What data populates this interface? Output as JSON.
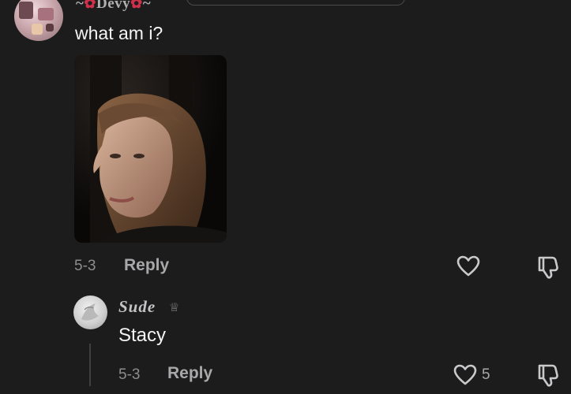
{
  "comment": {
    "username": "Devy",
    "username_decor_left": "~",
    "username_decor_right": "~",
    "text": "what am i?",
    "date": "5-3",
    "reply_label": "Reply",
    "has_photo": true
  },
  "reply": {
    "username": "Sude",
    "badge_glyph": "♕",
    "text": "Stacy",
    "date": "5-3",
    "reply_label": "Reply",
    "like_count": "5"
  },
  "colors": {
    "background": "#1c1c1d",
    "primary_text": "#f4f4f4",
    "secondary_text": "#8d8d8f",
    "action_text": "#a8a8aa",
    "flower_accent": "#d0304a"
  },
  "icons": {
    "like": "heart-outline-icon",
    "dislike": "thumbs-down-outline-icon",
    "flower": "flower-emoji",
    "crown": "crown-icon"
  }
}
